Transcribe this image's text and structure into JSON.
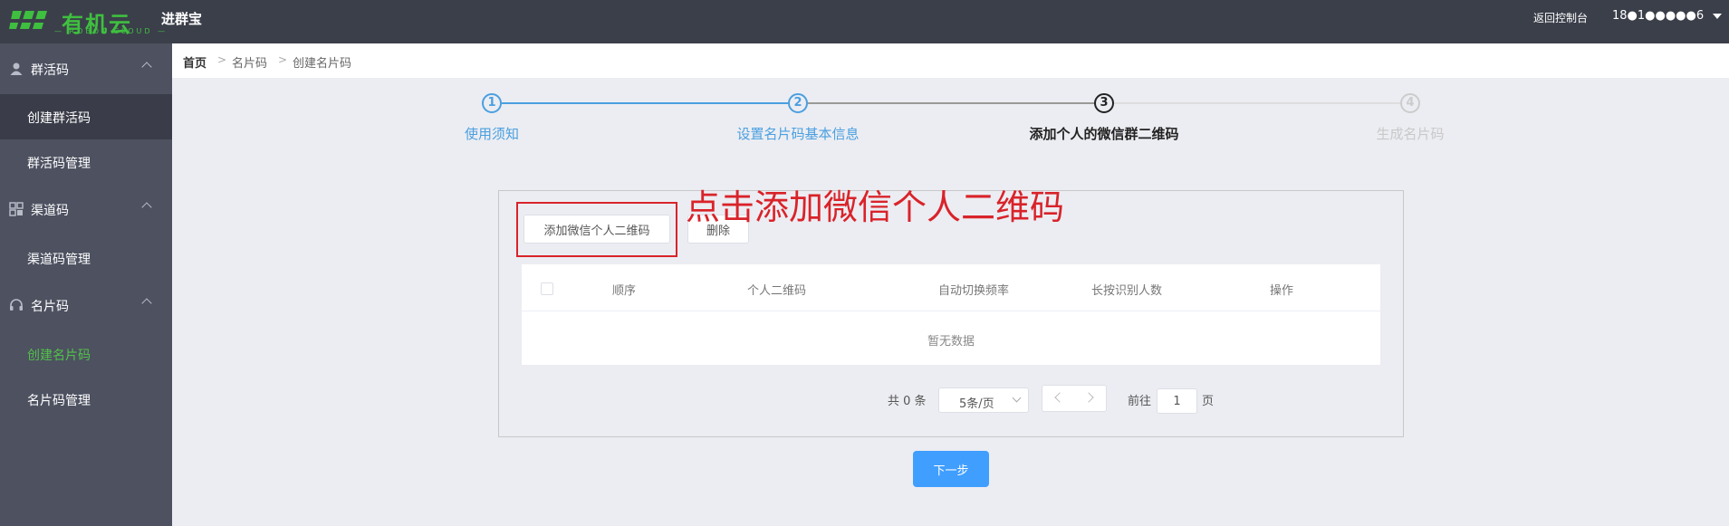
{
  "header": {
    "logo_text": "有机云",
    "logo_subtext": "— ROBOT CLOUD —",
    "product_name": "进群宝",
    "back_link": "返回控制台",
    "user_name": "18●1●●●●●6"
  },
  "sidebar": {
    "groups": [
      {
        "label": "群活码",
        "icon": "user-icon",
        "items": [
          "创建群活码",
          "群活码管理"
        ]
      },
      {
        "label": "渠道码",
        "icon": "grid-icon",
        "items": [
          "渠道码管理"
        ]
      },
      {
        "label": "名片码",
        "icon": "headset-icon",
        "items": [
          "创建名片码",
          "名片码管理"
        ]
      }
    ],
    "active_item": "创建名片码"
  },
  "breadcrumb": [
    "首页",
    "名片码",
    "创建名片码"
  ],
  "steps": [
    {
      "num": "1",
      "label": "使用须知",
      "state": "done"
    },
    {
      "num": "2",
      "label": "设置名片码基本信息",
      "state": "done"
    },
    {
      "num": "3",
      "label": "添加个人的微信群二维码",
      "state": "current"
    },
    {
      "num": "4",
      "label": "生成名片码",
      "state": "future"
    }
  ],
  "toolbar": {
    "add_label": "添加微信个人二维码",
    "delete_label": "删除"
  },
  "annotation": "点击添加微信个人二维码",
  "table": {
    "columns": [
      "顺序",
      "个人二维码",
      "自动切换频率",
      "长按识别人数",
      "操作"
    ],
    "empty_text": "暂无数据"
  },
  "pagination": {
    "total_text": "共 0 条",
    "page_size": "5条/页",
    "goto_label": "前往",
    "current_page": "1",
    "page_suffix": "页"
  },
  "next_button": "下一步",
  "colors": {
    "accent": "#409eff",
    "annotation": "#d9232a",
    "logo_green": "#3fbf3f"
  }
}
